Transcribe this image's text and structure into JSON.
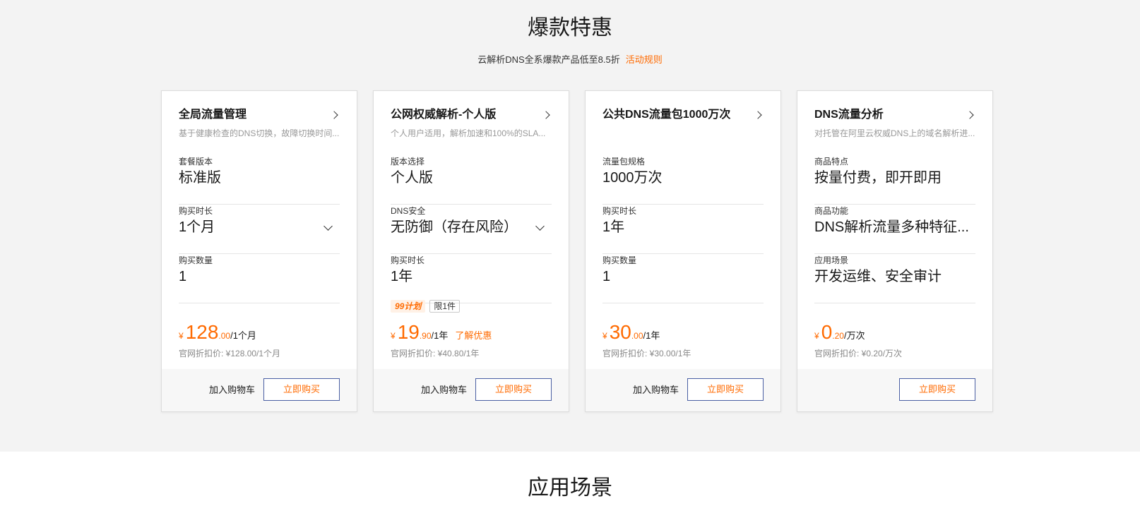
{
  "promo": {
    "title": "爆款特惠",
    "subtitle": "云解析DNS全系爆款产品低至8.5折",
    "rule_link": "活动规则"
  },
  "cards": [
    {
      "title": "全局流量管理",
      "desc": "基于健康检查的DNS切换，故障切换时间...",
      "fields": [
        {
          "label": "套餐版本",
          "value": "标准版"
        },
        {
          "label": "购买时长",
          "value": "1个月"
        },
        {
          "label": "购买数量",
          "value": "1"
        }
      ],
      "price": {
        "currency": "¥",
        "int": "128",
        "dec": ".00",
        "unit": "/1个月"
      },
      "orig": "官网折扣价: ¥128.00/1个月",
      "cart": "加入购物车",
      "buy": "立即购买"
    },
    {
      "title": "公网权威解析-个人版",
      "desc": "个人用户适用，解析加速和100%的SLA...",
      "fields": [
        {
          "label": "版本选择",
          "value": "个人版"
        },
        {
          "label": "DNS安全",
          "value": "无防御（存在风险）"
        },
        {
          "label": "购买时长",
          "value": "1年"
        }
      ],
      "tags": {
        "plan": "99计划",
        "limit": "限1件"
      },
      "price": {
        "currency": "¥",
        "int": "19",
        "dec": ".90",
        "unit": "/1年",
        "learn": "了解优惠"
      },
      "orig": "官网折扣价: ¥40.80/1年",
      "cart": "加入购物车",
      "buy": "立即购买"
    },
    {
      "title": "公共DNS流量包1000万次",
      "desc": "",
      "fields": [
        {
          "label": "流量包规格",
          "value": "1000万次"
        },
        {
          "label": "购买时长",
          "value": "1年"
        },
        {
          "label": "购买数量",
          "value": "1"
        }
      ],
      "price": {
        "currency": "¥",
        "int": "30",
        "dec": ".00",
        "unit": "/1年"
      },
      "orig": "官网折扣价: ¥30.00/1年",
      "cart": "加入购物车",
      "buy": "立即购买"
    },
    {
      "title": "DNS流量分析",
      "desc": "对托管在阿里云权威DNS上的域名解析进...",
      "fields": [
        {
          "label": "商品特点",
          "value": "按量付费，即开即用"
        },
        {
          "label": "商品功能",
          "value": "DNS解析流量多种特征..."
        },
        {
          "label": "应用场景",
          "value": "开发运维、安全审计"
        }
      ],
      "price": {
        "currency": "¥",
        "int": "0",
        "dec": ".20",
        "unit": "/万次"
      },
      "orig": "官网折扣价: ¥0.20/万次",
      "buy": "立即购买"
    }
  ],
  "section2": {
    "title": "应用场景"
  }
}
